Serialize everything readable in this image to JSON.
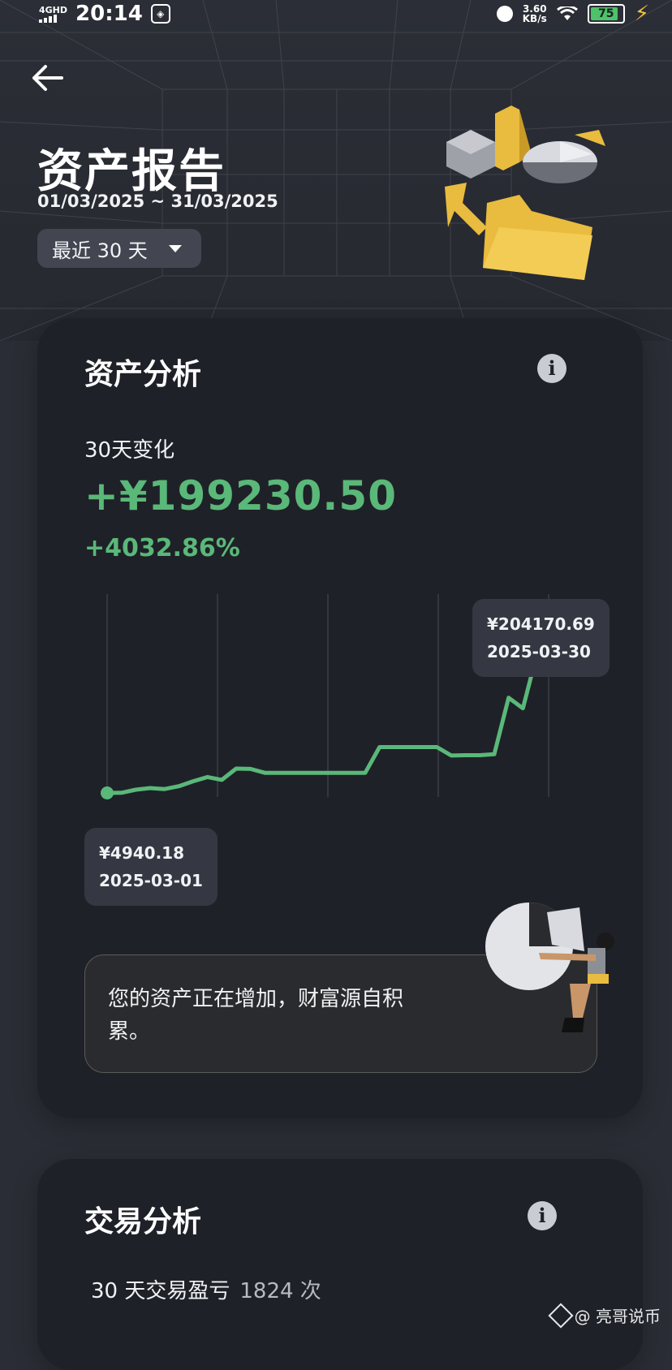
{
  "status_bar": {
    "network": "4GHD",
    "time": "20:14",
    "speed_value": "3.60",
    "speed_unit": "KB/s",
    "battery": "75"
  },
  "header": {
    "title": "资产报告",
    "date_range": "01/03/2025 ~ 31/03/2025",
    "period_select": "最近 30 天"
  },
  "asset_card": {
    "title": "资产分析",
    "change_label": "30天变化",
    "change_amount": "+¥199230.50",
    "change_percent": "+4032.86%",
    "start_point": {
      "value": "¥4940.18",
      "date": "2025-03-01"
    },
    "end_point": {
      "value": "¥204170.69",
      "date": "2025-03-30"
    },
    "message": "您的资产正在增加，财富源自积累。"
  },
  "chart_data": {
    "type": "line",
    "series": [
      {
        "values": [
          4940,
          5200,
          9500,
          11800,
          10500,
          14500,
          21500,
          27500,
          23500,
          39500,
          39000,
          33500,
          33500,
          33500,
          33500,
          33500,
          33500,
          33500,
          33500,
          70000,
          70000,
          70000,
          70000,
          70000,
          58000,
          58500,
          58500,
          60000,
          140000,
          125000,
          204170.69
        ]
      }
    ],
    "x": [
      "2025-03-01",
      "2025-03-30"
    ],
    "accent_color": "#5ab879"
  },
  "trade_card": {
    "title": "交易分析",
    "pnl_label": "30 天交易盈亏",
    "pnl_count": "1824 次"
  },
  "watermark": "@ 亮哥说币"
}
